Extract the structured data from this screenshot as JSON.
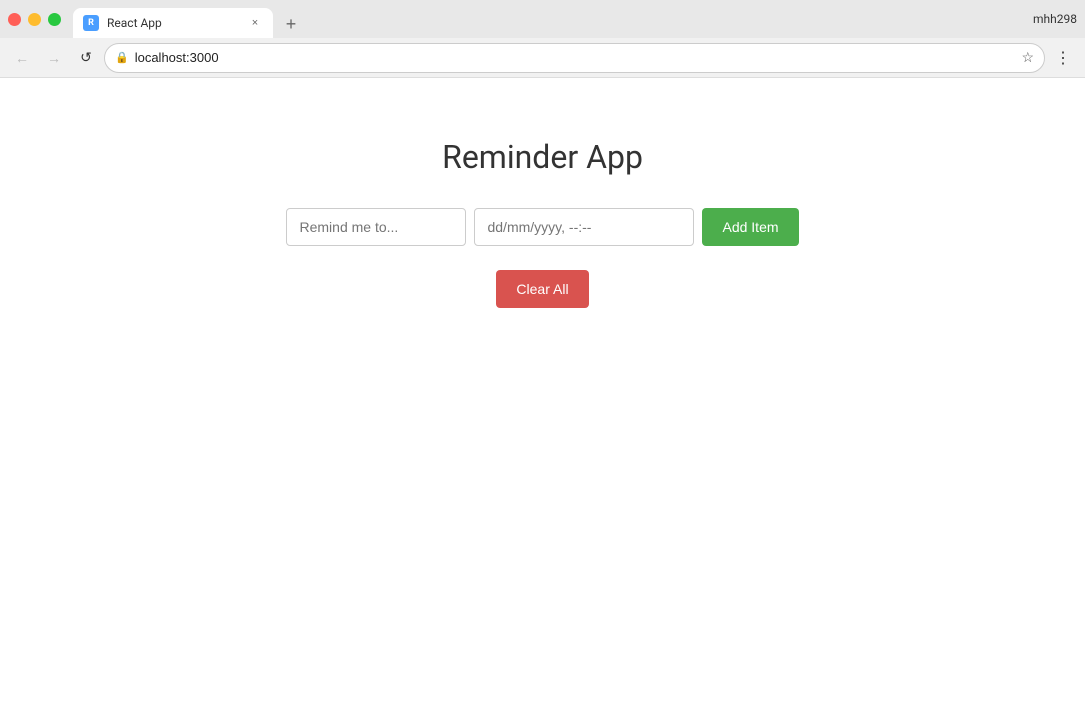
{
  "browser": {
    "tab_title": "React App",
    "tab_favicon_label": "R",
    "url": "localhost:3000",
    "user": "mhh298",
    "new_tab_label": "+",
    "close_tab_label": "×"
  },
  "toolbar": {
    "back_icon": "←",
    "forward_icon": "→",
    "refresh_icon": "↺",
    "lock_icon": "🔒",
    "star_icon": "☆",
    "menu_icon": "⋮"
  },
  "app": {
    "title": "Reminder App",
    "text_input_placeholder": "Remind me to...",
    "date_input_placeholder": "dd/mm/yyyy, --:--",
    "add_button_label": "Add Item",
    "clear_button_label": "Clear All"
  }
}
